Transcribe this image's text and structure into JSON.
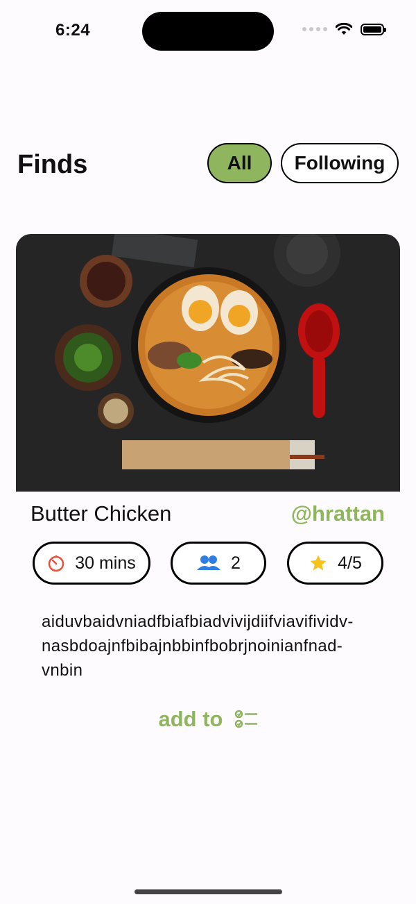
{
  "status_bar": {
    "time": "6:24",
    "icons": [
      "cellular-signal-icon",
      "wifi-icon",
      "battery-icon"
    ]
  },
  "header": {
    "title": "Finds",
    "filters": [
      {
        "label": "All",
        "selected": true
      },
      {
        "label": "Following",
        "selected": false
      }
    ]
  },
  "post": {
    "image_icon": "ramen-bowl-photo",
    "title": "Butter Chicken",
    "author": "@hrattan",
    "time": "30 mins",
    "servings": "2",
    "rating": "4/5",
    "description": "aiduvbaidvniadfbiafbiadvivijdiifviavifividv-nasbdoajnfbibajnbbinfbobrjnoinianfnad-vnbin",
    "add_to_label": "add to"
  },
  "colors": {
    "accent": "#8fb55e",
    "timer_icon": "#e8503a",
    "people_icon": "#2f7ee0",
    "star_icon": "#f6c21b",
    "background": "#fdfbfe"
  }
}
